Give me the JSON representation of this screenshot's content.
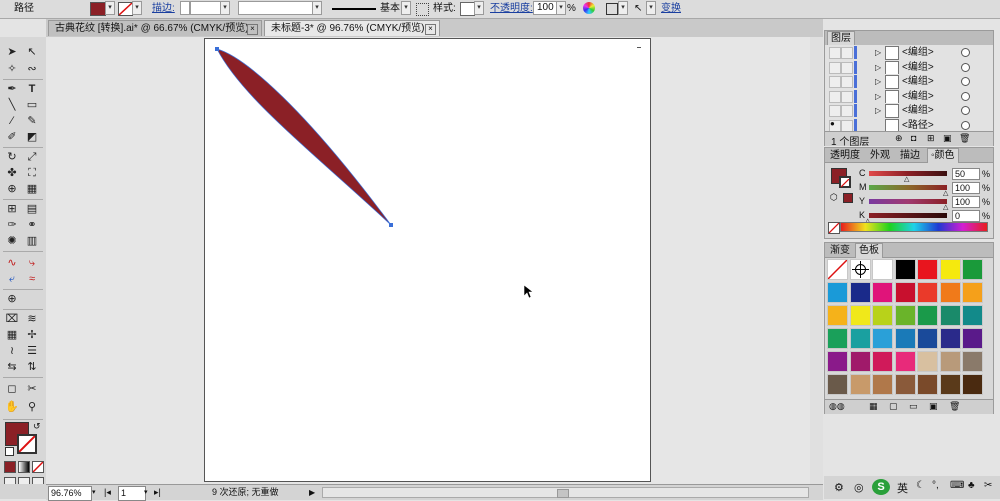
{
  "control_bar": {
    "selection_label": "路径",
    "fill_color": "#8b2026",
    "stroke_label": "描边:",
    "stroke_style_label": "基本",
    "style_label": "样式:",
    "opacity_label": "不透明度:",
    "opacity_value": "100",
    "opacity_unit": "%",
    "transform_label": "变换"
  },
  "tabs": [
    {
      "label": "古典花纹 [转换].ai* @ 66.67% (CMYK/预览)",
      "active": false
    },
    {
      "label": "未标题-3* @ 96.76% (CMYK/预览)",
      "active": true
    }
  ],
  "tools": {
    "fill_swatch": "#8b2026"
  },
  "artwork": {
    "shape_color": "#8b2026",
    "anchor_color": "#3a6fd8"
  },
  "status_bar": {
    "zoom": "96.76%",
    "page": "1",
    "undo_status": "9 次还原; 无重做"
  },
  "layers_panel": {
    "title": "图层",
    "rows": [
      {
        "name": "<编组>"
      },
      {
        "name": "<编组>"
      },
      {
        "name": "<编组>"
      },
      {
        "name": "<编组>"
      },
      {
        "name": "<编组>"
      },
      {
        "name": "<路径>"
      }
    ],
    "count_label": "1 个图层"
  },
  "color_panel": {
    "tabs": [
      "透明度",
      "外观",
      "描边",
      "颜色"
    ],
    "active_tab": "颜色",
    "channels": [
      {
        "label": "C",
        "value": "50",
        "unit": "%",
        "level": 0.5,
        "track": "linear-gradient(to right,#e14a4a,#8b2026,#3a1010)"
      },
      {
        "label": "M",
        "value": "100",
        "unit": "%",
        "level": 1.0,
        "track": "linear-gradient(to right,#5aa84a,#8b6a2a,#8b2026)"
      },
      {
        "label": "Y",
        "value": "100",
        "unit": "%",
        "level": 1.0,
        "track": "linear-gradient(to right,#7a3aa0,#a03a70,#8b2026)"
      },
      {
        "label": "K",
        "value": "0",
        "unit": "%",
        "level": 0.0,
        "track": "linear-gradient(to right,#8b2026,#2a0a0a)"
      }
    ]
  },
  "swatches_panel": {
    "tabs": [
      "渐变",
      "色板"
    ],
    "active_tab": "色板",
    "rows": [
      [
        "none",
        "registration",
        "#ffffff",
        "#000000",
        "#e8151e",
        "#f5e90e",
        "#1a9a3a"
      ],
      [
        "#1a9ad8",
        "#1a2a8a",
        "#e0147a",
        "#c8102e",
        "#ea3a2a",
        "#f07a1a",
        "#f5a01a"
      ],
      [
        "#f5b21a",
        "#f0e81a",
        "#b8d21a",
        "#6ab42a",
        "#1a9a4a",
        "#1a8a6a",
        "#128a8a"
      ],
      [
        "#1aa05a",
        "#1aa0a0",
        "#2aa0d8",
        "#1a7ab8",
        "#1a4a9a",
        "#2a2a8a",
        "#5a1a8a"
      ],
      [
        "#8a1a8a",
        "#a01a6a",
        "#d01a5a",
        "#e82a7a",
        "#d8c0a0",
        "#b89a7a",
        "#8a7a6a"
      ],
      [
        "#6a5a4a",
        "#c89a6a",
        "#b0784a",
        "#8a5a3a",
        "#7a4a2a",
        "#5a3a1a",
        "#4a2a10"
      ]
    ]
  },
  "tray": {
    "ime_label": "英"
  }
}
